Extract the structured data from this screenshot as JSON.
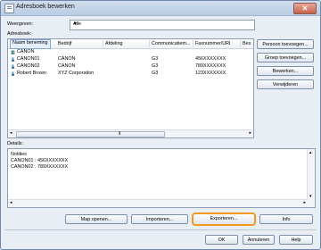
{
  "window": {
    "title": "Adresboek bewerken",
    "close": "✕"
  },
  "weergeven": {
    "label": "Weergeven:",
    "value": "Alle"
  },
  "adresboek_label": "Adresboek:",
  "columns": [
    "Naam beneming",
    "Bedrijf",
    "Afdeling",
    "Communicatiem...",
    "Faxnummer/URI",
    "Bes"
  ],
  "rows": [
    {
      "name": "CANON",
      "company": "",
      "dept": "",
      "comm": "",
      "fax": "",
      "type": "group"
    },
    {
      "name": "CANON01",
      "company": "CANON",
      "dept": "",
      "comm": "G3",
      "fax": "456XXXXXXX",
      "type": "person"
    },
    {
      "name": "CANON02",
      "company": "CANON",
      "dept": "",
      "comm": "G3",
      "fax": "789XXXXXXX",
      "type": "person"
    },
    {
      "name": "Robert Brown",
      "company": "XYZ Corporation",
      "dept": "",
      "comm": "G3",
      "fax": "123XXXXXXX",
      "type": "person"
    }
  ],
  "side_buttons": [
    "Persoon toevoegen...",
    "Groep toevoegen...",
    "Bewerken...",
    "Verwijderen"
  ],
  "details": {
    "label": "Details:",
    "lines": [
      "Notities",
      "CANON01 : 456XXXXXXX",
      "CANON02 : 789XXXXXXX"
    ]
  },
  "bottom_buttons": [
    "Map openen...",
    "Importeren...",
    "Exporteren...",
    "Info"
  ],
  "footer_buttons": [
    "OK",
    "Annuleren",
    "Help"
  ],
  "colors": {
    "highlight": "#f29a1f",
    "title_bg": "#c4d5e9"
  }
}
